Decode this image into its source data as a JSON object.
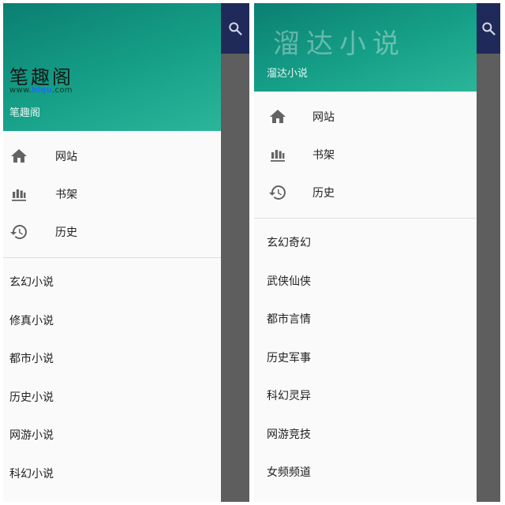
{
  "left": {
    "header": {
      "logo_title": "笔趣阁",
      "logo_url_prefix": "www.",
      "logo_url_highlight": "biqu",
      "logo_url_suffix": ".com",
      "subtitle": "笔趣阁"
    },
    "nav": [
      {
        "label": "网站",
        "icon": "home-icon"
      },
      {
        "label": "书架",
        "icon": "bookshelf-icon"
      },
      {
        "label": "历史",
        "icon": "history-icon"
      }
    ],
    "categories": [
      "玄幻小说",
      "修真小说",
      "都市小说",
      "历史小说",
      "网游小说",
      "科幻小说"
    ]
  },
  "right": {
    "header": {
      "watermark": "溜达小说",
      "subtitle": "溜达小说"
    },
    "nav": [
      {
        "label": "网站",
        "icon": "home-icon"
      },
      {
        "label": "书架",
        "icon": "bookshelf-icon"
      },
      {
        "label": "历史",
        "icon": "history-icon"
      }
    ],
    "categories": [
      "玄幻奇幻",
      "武侠仙侠",
      "都市言情",
      "历史军事",
      "科幻灵异",
      "网游竞技",
      "女频频道"
    ]
  },
  "colors": {
    "header_gradient_start": "#0b7f72",
    "header_gradient_end": "#2bb69a",
    "app_bar": "#1f2a5a",
    "scrim": "#5e5e5e",
    "drawer_bg": "#fafafa",
    "text": "#212121"
  }
}
